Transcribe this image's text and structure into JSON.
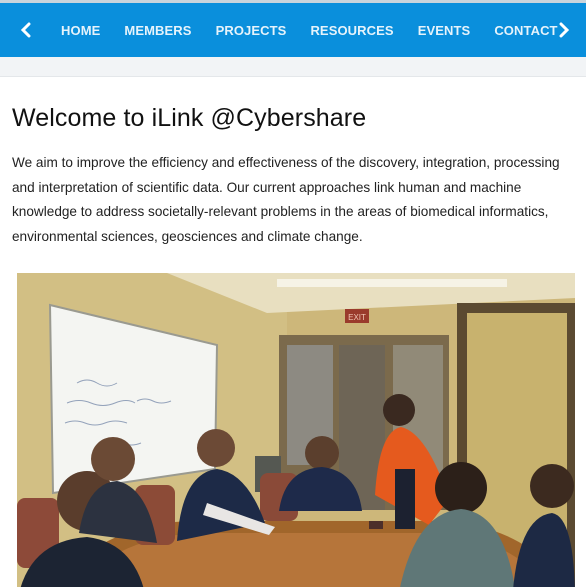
{
  "nav": {
    "prev_icon": "chevron-left-icon",
    "next_icon": "chevron-right-icon",
    "items": [
      "HOME",
      "MEMBERS",
      "PROJECTS",
      "RESOURCES",
      "EVENTS",
      "CONTACT"
    ],
    "bar_color": "#0a8fdc"
  },
  "main": {
    "title": "Welcome to iLink @Cybershare",
    "intro": "We aim to improve the efficiency and effectiveness of the discovery, integration, processing and interpretation of scientific data. Our current approaches link human and machine knowledge to address societally-relevant problems in the areas of biomedical informatics, environmental sciences, geosciences and climate change.",
    "photo": {
      "exit_sign": "EXIT"
    }
  }
}
